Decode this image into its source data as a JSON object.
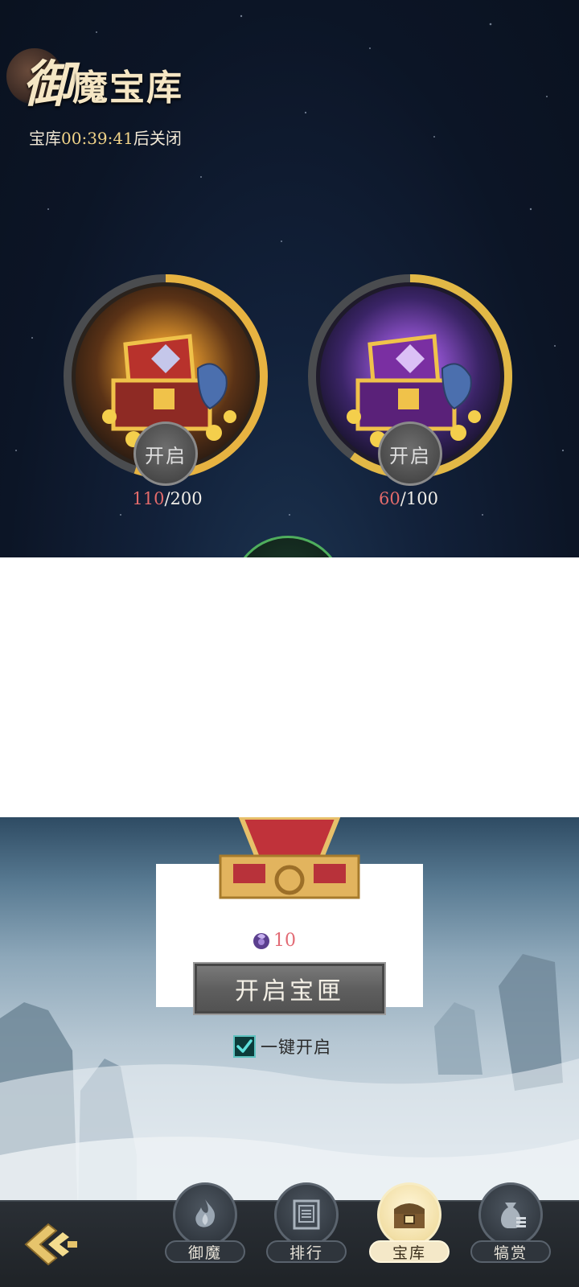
{
  "header": {
    "title_first_char": "御",
    "title_rest": "魔宝库",
    "timer_prefix": "宝库",
    "countdown": "00:39:41",
    "timer_suffix": "后关闭"
  },
  "chests": [
    {
      "name": "gold",
      "open_label": "开启",
      "current": "110",
      "total": "/200",
      "progress": 0.55,
      "ring_color": "#e7b341"
    },
    {
      "name": "purple",
      "open_label": "开启",
      "current": "60",
      "total": "/100",
      "progress": 0.6,
      "ring_color": "#e2b846"
    }
  ],
  "open_dialog": {
    "cost_value": "10",
    "open_button_label": "开启宝匣",
    "one_key_label": "一键开启",
    "one_key_checked": true
  },
  "nav": {
    "items": [
      {
        "label": "御魔",
        "icon": "flame-icon",
        "active": false
      },
      {
        "label": "排行",
        "icon": "ranking-scroll-icon",
        "active": false
      },
      {
        "label": "宝库",
        "icon": "treasure-chest-icon",
        "active": true
      },
      {
        "label": "犒赏",
        "icon": "reward-bag-icon",
        "active": false
      }
    ],
    "back_icon": "back-arrow-icon"
  },
  "colors": {
    "accent_gold": "#f2d489",
    "progress_red": "#e46b6b",
    "check_teal": "#5ec2bf"
  }
}
